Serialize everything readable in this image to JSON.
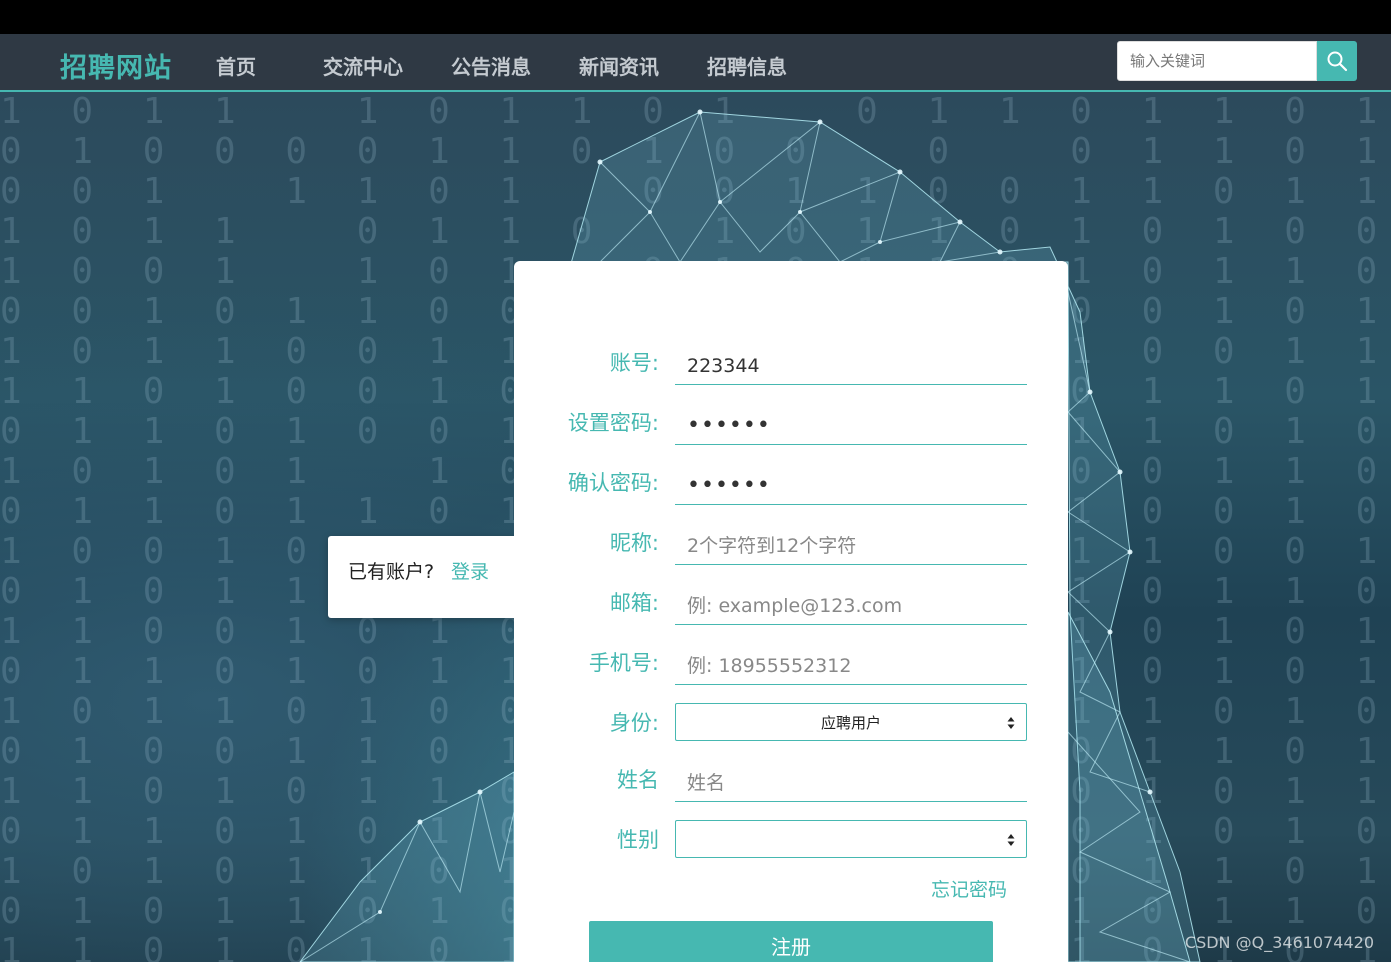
{
  "nav": {
    "brand": "招聘网站",
    "items": [
      {
        "label": "首页"
      },
      {
        "label": "交流中心"
      },
      {
        "label": "公告消息"
      },
      {
        "label": "新闻资讯"
      },
      {
        "label": "招聘信息"
      }
    ],
    "search_placeholder": "输入关键词"
  },
  "login_prompt": {
    "text": "已有账户?",
    "link": "登录"
  },
  "form": {
    "account": {
      "label": "账号:",
      "value": "223344"
    },
    "password": {
      "label": "设置密码:",
      "value": "••••••"
    },
    "confirm_password": {
      "label": "确认密码:",
      "value": "••••••"
    },
    "nickname": {
      "label": "昵称:",
      "placeholder": "2个字符到12个字符"
    },
    "email": {
      "label": "邮箱:",
      "placeholder": "例: example@123.com"
    },
    "phone": {
      "label": "手机号:",
      "placeholder": "例: 18955552312"
    },
    "identity": {
      "label": "身份:",
      "selected": "应聘用户"
    },
    "name": {
      "label": "姓名",
      "placeholder": "姓名"
    },
    "gender": {
      "label": "性别",
      "selected": ""
    },
    "forgot_password": "忘记密码",
    "register_button": "注册"
  },
  "watermark": "CSDN @Q_3461074420",
  "colors": {
    "accent": "#46b8b1",
    "navbar": "#2f3944"
  }
}
